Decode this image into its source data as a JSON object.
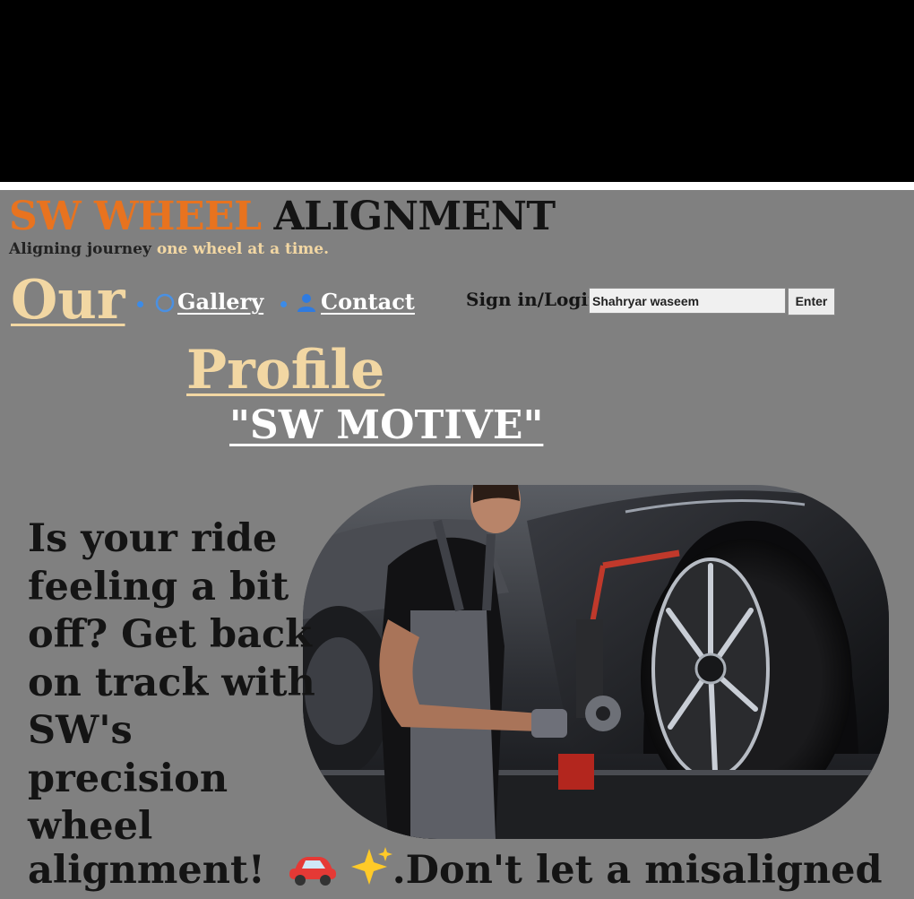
{
  "header": {
    "brand_part1": "SW WHEEL",
    "brand_part2": "ALIGNMENT",
    "tagline_part1": "Aligning journey",
    "tagline_part2": "one wheel at a time."
  },
  "nav": {
    "our": "Our",
    "gallery": "Gallery",
    "contact": "Contact",
    "profile": "Profile"
  },
  "signin": {
    "label": "Sign in/Login",
    "username_value": "Shahryar waseem",
    "enter_label": "Enter"
  },
  "company": {
    "name": "\"SW MOTIVE\""
  },
  "hero": {
    "image_icon": "mechanic-wheel-alignment-photo"
  },
  "pitch": {
    "text": "Is your ride feeling a bit off? Get back on track with SW's precision wheel",
    "last_line_start": "alignment!",
    "last_line_end": ".Don't let a misaligned"
  },
  "icons": {
    "gallery": "gallery-ring-icon",
    "contact": "person-icon",
    "car": "red-car-emoji",
    "sparkles": "sparkles-emoji"
  },
  "colors": {
    "page_bg": "#808080",
    "brand_orange": "#e8731f",
    "accent_tan": "#f2d7a3",
    "bullet_blue": "#3b8be8"
  }
}
